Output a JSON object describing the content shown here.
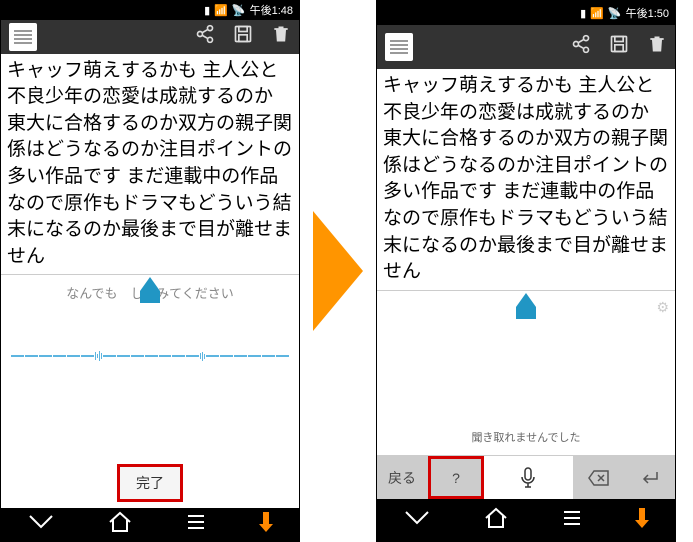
{
  "screens": {
    "left": {
      "status_time": "午後1:48",
      "text_body": "キャッフ萌えするかも 主人公と不良少年の恋愛は成就するのか 東大に合格するのか双方の親子関係はどうなるのか注目ポイントの多い作品です まだ連載中の作品なので原作もドラマもどういう結末になるのか最後まで目が離せません",
      "voice_prompt": "なんでも　してみてください",
      "complete_label": "完了"
    },
    "right": {
      "status_time": "午後1:50",
      "text_body": "キャッフ萌えするかも 主人公と不良少年の恋愛は成就するのか 東大に合格するのか双方の親子関係はどうなるのか注目ポイントの多い作品です まだ連載中の作品なので原作もドラマもどういう結末になるのか最後まで目が離せません",
      "error_message": "聞き取れませんでした",
      "kb_back": "戻る",
      "kb_question": "?"
    }
  }
}
